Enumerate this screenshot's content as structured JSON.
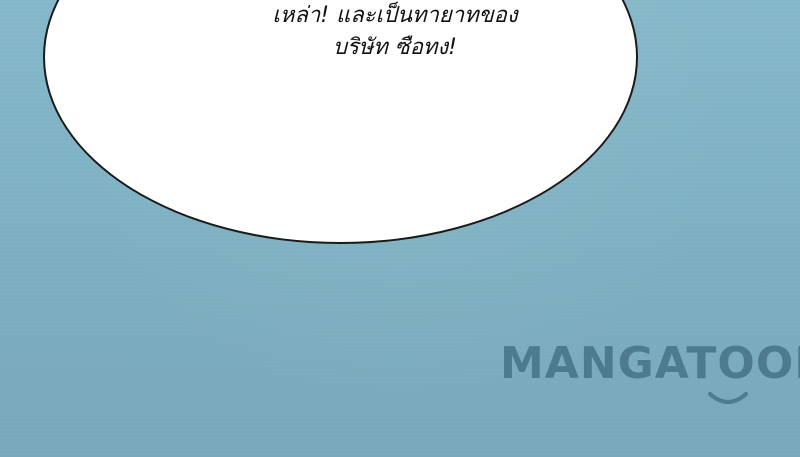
{
  "speech_bubble": {
    "lines": [
      "เหล่า! และเป็นทายาทของ",
      "บริษัท ซือทง!"
    ]
  },
  "watermark": {
    "text": "MANGATOON",
    "color": "#4d7a8c"
  },
  "colors": {
    "background": "#7fb2c4",
    "bubble_fill": "#ffffff",
    "bubble_outline": "#1a1a1a",
    "text": "#111111"
  }
}
